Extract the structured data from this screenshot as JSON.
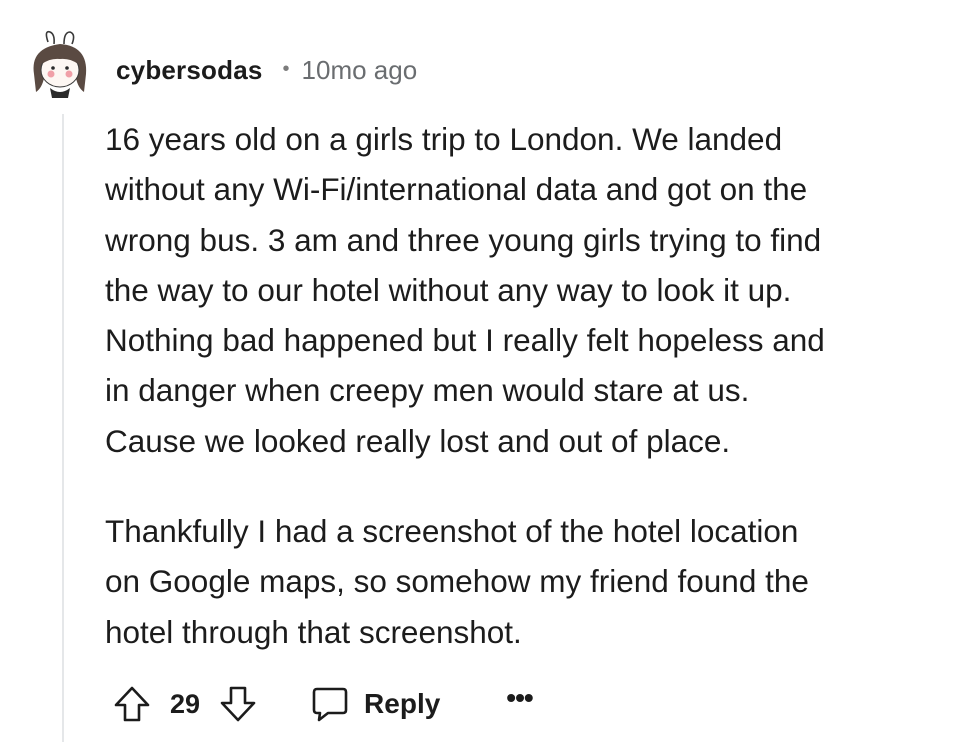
{
  "comment": {
    "username": "cybersodas",
    "separator": "•",
    "timestamp": "10mo ago",
    "paragraphs": [
      "16 years old on a girls trip to London. We landed\nwithout any Wi-Fi/international data and got on the\nwrong bus. 3 am and three young girls trying to find\nthe way to our hotel without any way to look it up.\nNothing bad happened but I really felt hopeless and\nin danger when creepy men would stare at us.\nCause we looked really lost and out of place.",
      "Thankfully I had a screenshot of the hotel location\non Google maps, so somehow my friend found the\nhotel through that screenshot."
    ],
    "vote_count": "29",
    "reply_label": "Reply",
    "more_label": "•••"
  },
  "icons": {
    "avatar": "avatar-icon",
    "upvote": "upvote-arrow-icon",
    "downvote": "downvote-arrow-icon",
    "reply": "speech-bubble-icon",
    "more": "more-options-icon"
  },
  "colors": {
    "text": "#1c1c1c",
    "meta": "#6a6d70",
    "thread_line": "#e5e7e9",
    "background": "#ffffff"
  }
}
